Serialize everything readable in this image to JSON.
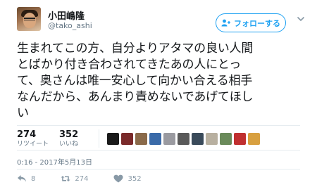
{
  "user": {
    "display_name": "小田嶋隆",
    "screen_name": "@tako_ashi"
  },
  "follow_button": {
    "label": "フォローする",
    "icon": "add-user-icon"
  },
  "menu_icon": "chevron-down-icon",
  "tweet": {
    "lines": [
      "生まれてこの方、自分よりアタマの良い人間",
      "とばかり付き合わされてきたあの人にとっ",
      "て、奥さんは唯一安心して向かい合える相手",
      "なんだから、あんまり責めないであげてほし",
      "い"
    ]
  },
  "stats": {
    "retweets": {
      "count": "274",
      "label": "リツイート"
    },
    "likes": {
      "count": "352",
      "label": "いいね"
    }
  },
  "likers": [
    {
      "name": "liker-1",
      "color": "#1a1a1a"
    },
    {
      "name": "liker-2",
      "color": "#7a2a2a"
    },
    {
      "name": "liker-3",
      "color": "#8a6a4a"
    },
    {
      "name": "liker-4",
      "color": "#3a6aa8"
    },
    {
      "name": "liker-5",
      "color": "#9a9aa0"
    },
    {
      "name": "liker-6",
      "color": "#5a5a5a"
    },
    {
      "name": "liker-7",
      "color": "#3a4a5a"
    },
    {
      "name": "liker-8",
      "color": "#b8b0a0"
    },
    {
      "name": "liker-9",
      "color": "#6a8a5a"
    },
    {
      "name": "liker-10",
      "color": "#c03030"
    },
    {
      "name": "liker-11",
      "color": "#d8a040"
    }
  ],
  "timestamp": "0:16 - 2017年5月13日",
  "actions": {
    "reply": {
      "count": "8",
      "icon": "reply-icon"
    },
    "retweet": {
      "count": "274",
      "icon": "retweet-icon"
    },
    "like": {
      "count": "352",
      "icon": "heart-icon"
    }
  },
  "colors": {
    "accent": "#1da1f2",
    "muted": "#657786"
  }
}
